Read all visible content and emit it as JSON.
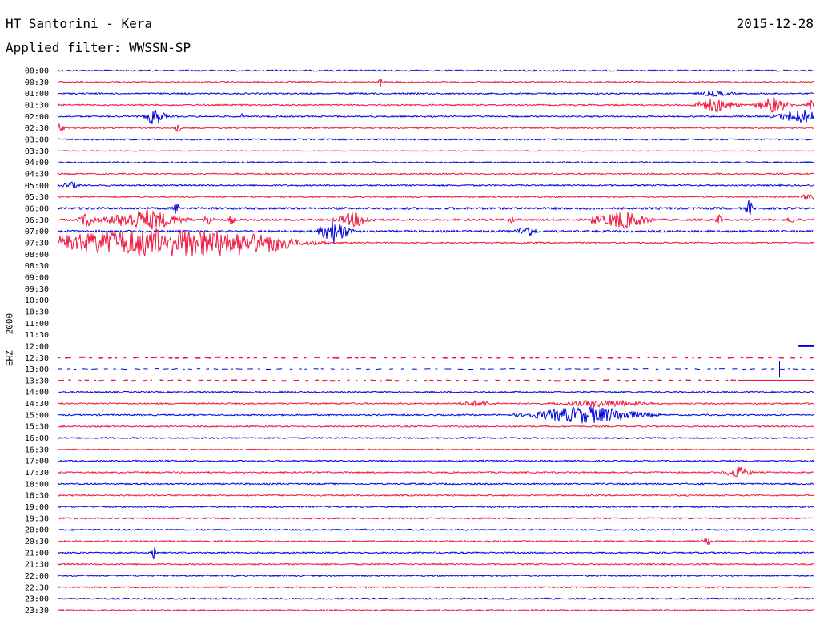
{
  "header": {
    "station": "HT Santorini - Kera",
    "date": "2015-12-28",
    "filter": "Applied filter: WWSSN-SP"
  },
  "channel_label": "EHZ - 2000",
  "colors": {
    "even_trace": "#0000e0",
    "odd_trace": "#f0143c",
    "background": "#ffffff",
    "text": "#000000"
  },
  "chart_data": {
    "type": "line",
    "title": "HT Santorini - Kera",
    "subtitle": "Applied filter: WWSSN-SP",
    "ylabel": "EHZ - 2000",
    "tick_labels": [
      "00:00",
      "00:30",
      "01:00",
      "01:30",
      "02:00",
      "02:30",
      "03:00",
      "03:30",
      "04:00",
      "04:30",
      "05:00",
      "05:30",
      "06:00",
      "06:30",
      "07:00",
      "07:30",
      "08:00",
      "08:30",
      "09:00",
      "09:30",
      "10:00",
      "10:30",
      "11:00",
      "11:30",
      "12:00",
      "12:30",
      "13:00",
      "13:30",
      "14:00",
      "14:30",
      "15:00",
      "15:30",
      "16:00",
      "16:30",
      "17:00",
      "17:30",
      "18:00",
      "18:30",
      "19:00",
      "19:30",
      "20:00",
      "20:30",
      "21:00",
      "21:30",
      "22:00",
      "22:30",
      "23:00",
      "23:30"
    ],
    "x_unit": "fraction of 30-minute line",
    "amplitude_unit": "relative trace amplitude",
    "lines": [
      {
        "label": "00:00",
        "state": "normal",
        "noise": 1.0,
        "events": []
      },
      {
        "label": "00:30",
        "state": "normal",
        "noise": 1.0,
        "events": [
          {
            "x": 0.427,
            "amp": 7,
            "dur": 0.002
          }
        ]
      },
      {
        "label": "01:00",
        "state": "normal",
        "noise": 1.0,
        "events": [
          {
            "x": 0.87,
            "amp": 3,
            "dur": 0.02
          }
        ]
      },
      {
        "label": "01:30",
        "state": "normal",
        "noise": 1.0,
        "events": [
          {
            "x": 0.87,
            "amp": 9,
            "dur": 0.025
          },
          {
            "x": 0.946,
            "amp": 10,
            "dur": 0.02
          },
          {
            "x": 0.998,
            "amp": 9,
            "dur": 0.006
          }
        ]
      },
      {
        "label": "02:00",
        "state": "normal",
        "noise": 1.0,
        "events": [
          {
            "x": 0.129,
            "amp": 11,
            "dur": 0.012
          },
          {
            "x": 0.243,
            "amp": 3,
            "dur": 0.003
          },
          {
            "x": 0.985,
            "amp": 9,
            "dur": 0.03
          }
        ]
      },
      {
        "label": "02:30",
        "state": "normal",
        "noise": 1.0,
        "events": [
          {
            "x": 0.002,
            "amp": 6,
            "dur": 0.006
          },
          {
            "x": 0.159,
            "amp": 6,
            "dur": 0.003
          }
        ]
      },
      {
        "label": "03:00",
        "state": "normal",
        "noise": 1.0,
        "events": []
      },
      {
        "label": "03:30",
        "state": "normal",
        "noise": 0.6,
        "events": []
      },
      {
        "label": "04:00",
        "state": "normal",
        "noise": 1.0,
        "events": []
      },
      {
        "label": "04:30",
        "state": "normal",
        "noise": 1.0,
        "events": []
      },
      {
        "label": "05:00",
        "state": "normal",
        "noise": 1.0,
        "events": [
          {
            "x": 0.018,
            "amp": 4,
            "dur": 0.01
          }
        ]
      },
      {
        "label": "05:30",
        "state": "normal",
        "noise": 1.0,
        "events": [
          {
            "x": 0.995,
            "amp": 4,
            "dur": 0.01
          }
        ]
      },
      {
        "label": "06:00",
        "state": "normal",
        "noise": 1.5,
        "events": [
          {
            "x": 0.157,
            "amp": 8,
            "dur": 0.004
          },
          {
            "x": 0.915,
            "amp": 10,
            "dur": 0.004
          }
        ]
      },
      {
        "label": "06:30",
        "state": "normal",
        "noise": 1.4,
        "events": [
          {
            "x": 0.04,
            "amp": 9,
            "dur": 0.01
          },
          {
            "x": 0.115,
            "amp": 13,
            "dur": 0.045
          },
          {
            "x": 0.2,
            "amp": 8,
            "dur": 0.006
          },
          {
            "x": 0.23,
            "amp": 6,
            "dur": 0.004
          },
          {
            "x": 0.392,
            "amp": 9,
            "dur": 0.02
          },
          {
            "x": 0.6,
            "amp": 6,
            "dur": 0.004
          },
          {
            "x": 0.71,
            "amp": 7,
            "dur": 0.004
          },
          {
            "x": 0.748,
            "amp": 11,
            "dur": 0.03
          },
          {
            "x": 0.875,
            "amp": 6,
            "dur": 0.005
          },
          {
            "x": 0.97,
            "amp": 5,
            "dur": 0.004
          }
        ]
      },
      {
        "label": "07:00",
        "state": "normal",
        "noise": 1.4,
        "events": [
          {
            "x": 0.366,
            "amp": 16,
            "dur": 0.018
          },
          {
            "x": 0.62,
            "amp": 7,
            "dur": 0.012
          }
        ]
      },
      {
        "label": "07:30",
        "state": "normal",
        "noise": 1.0,
        "events": [
          {
            "x": 0.15,
            "amp": 13,
            "dur": 0.15
          }
        ],
        "burst_end": 0.31
      },
      {
        "label": "08:00",
        "state": "empty"
      },
      {
        "label": "08:30",
        "state": "empty"
      },
      {
        "label": "09:00",
        "state": "empty"
      },
      {
        "label": "09:30",
        "state": "empty"
      },
      {
        "label": "10:00",
        "state": "empty"
      },
      {
        "label": "10:30",
        "state": "empty"
      },
      {
        "label": "11:00",
        "state": "empty"
      },
      {
        "label": "11:30",
        "state": "empty"
      },
      {
        "label": "12:00",
        "state": "segment",
        "from": 0.98,
        "to": 1.0
      },
      {
        "label": "12:30",
        "state": "dashed"
      },
      {
        "label": "13:00",
        "state": "dashed",
        "events": [
          {
            "x": 0.955,
            "amp": 10,
            "dur": 0.004
          }
        ]
      },
      {
        "label": "13:30",
        "state": "dashed_then_solid",
        "solid_from": 0.9
      },
      {
        "label": "14:00",
        "state": "normal",
        "noise": 1.0,
        "events": []
      },
      {
        "label": "14:30",
        "state": "normal",
        "noise": 1.0,
        "events": [
          {
            "x": 0.555,
            "amp": 3,
            "dur": 0.02
          },
          {
            "x": 0.72,
            "amp": 4,
            "dur": 0.05
          }
        ]
      },
      {
        "label": "15:00",
        "state": "normal",
        "noise": 1.0,
        "events": [
          {
            "x": 0.7,
            "amp": 11,
            "dur": 0.07
          }
        ]
      },
      {
        "label": "15:30",
        "state": "normal",
        "noise": 1.0,
        "events": []
      },
      {
        "label": "16:00",
        "state": "normal",
        "noise": 1.0,
        "events": []
      },
      {
        "label": "16:30",
        "state": "normal",
        "noise": 0.7,
        "events": []
      },
      {
        "label": "17:00",
        "state": "normal",
        "noise": 1.0,
        "events": []
      },
      {
        "label": "17:30",
        "state": "normal",
        "noise": 1.0,
        "events": [
          {
            "x": 0.9,
            "amp": 7,
            "dur": 0.015
          }
        ]
      },
      {
        "label": "18:00",
        "state": "normal",
        "noise": 1.0,
        "events": []
      },
      {
        "label": "18:30",
        "state": "normal",
        "noise": 1.0,
        "events": []
      },
      {
        "label": "19:00",
        "state": "normal",
        "noise": 1.0,
        "events": []
      },
      {
        "label": "19:30",
        "state": "normal",
        "noise": 1.0,
        "events": []
      },
      {
        "label": "20:00",
        "state": "normal",
        "noise": 1.0,
        "events": []
      },
      {
        "label": "20:30",
        "state": "normal",
        "noise": 1.0,
        "events": [
          {
            "x": 0.86,
            "amp": 4,
            "dur": 0.006
          }
        ]
      },
      {
        "label": "21:00",
        "state": "normal",
        "noise": 1.0,
        "events": [
          {
            "x": 0.127,
            "amp": 8,
            "dur": 0.003
          }
        ]
      },
      {
        "label": "21:30",
        "state": "normal",
        "noise": 1.0,
        "events": []
      },
      {
        "label": "22:00",
        "state": "normal",
        "noise": 1.0,
        "events": []
      },
      {
        "label": "22:30",
        "state": "normal",
        "noise": 1.0,
        "events": []
      },
      {
        "label": "23:00",
        "state": "normal",
        "noise": 1.0,
        "events": []
      },
      {
        "label": "23:30",
        "state": "normal",
        "noise": 1.0,
        "events": []
      }
    ]
  }
}
